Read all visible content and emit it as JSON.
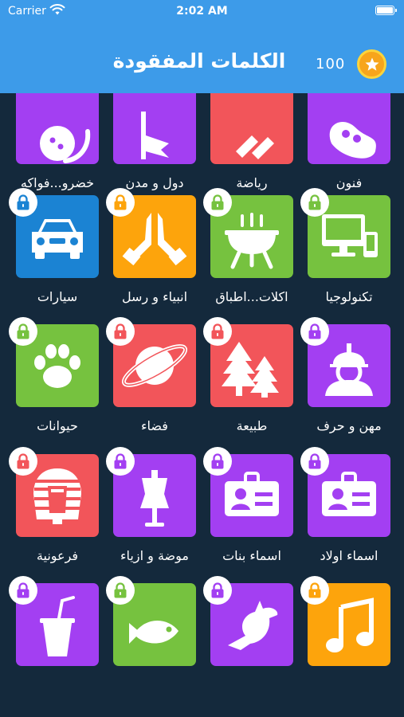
{
  "status_bar": {
    "carrier": "Carrier",
    "time": "2:02 AM"
  },
  "header": {
    "title": "الكلمات المفقودة",
    "coins": "100"
  },
  "colors": {
    "header": "#3d9be9",
    "background": "#14293c",
    "coin": "#f7a51c",
    "purple": "#a33ff2",
    "red": "#f2555a",
    "green": "#76c23f",
    "orange": "#fda40c",
    "blue": "#1b83d3"
  },
  "categories": [
    {
      "label": "فنون",
      "color": "#a33ff2",
      "icon": "palette-icon",
      "locked": false
    },
    {
      "label": "رياضة",
      "color": "#f2555a",
      "icon": "sport-icon",
      "locked": false
    },
    {
      "label": "دول و مدن",
      "color": "#a33ff2",
      "icon": "flag-icon",
      "locked": false
    },
    {
      "label": "خضرو...فواكه",
      "color": "#a33ff2",
      "icon": "fruit-icon",
      "locked": false
    },
    {
      "label": "تكنولوجيا",
      "color": "#76c23f",
      "icon": "computer-icon",
      "locked": true
    },
    {
      "label": "اكلات...اطباق",
      "color": "#76c23f",
      "icon": "grill-icon",
      "locked": true
    },
    {
      "label": "انبياء و رسل",
      "color": "#fda40c",
      "icon": "praying-hands-icon",
      "locked": true
    },
    {
      "label": "سيارات",
      "color": "#1b83d3",
      "icon": "car-icon",
      "locked": true
    },
    {
      "label": "مهن و حرف",
      "color": "#a33ff2",
      "icon": "worker-icon",
      "locked": true
    },
    {
      "label": "طبيعة",
      "color": "#f2555a",
      "icon": "trees-icon",
      "locked": true
    },
    {
      "label": "فضاء",
      "color": "#f2555a",
      "icon": "planet-icon",
      "locked": true
    },
    {
      "label": "حيوانات",
      "color": "#76c23f",
      "icon": "paw-icon",
      "locked": true
    },
    {
      "label": "اسماء اولاد",
      "color": "#a33ff2",
      "icon": "id-card-icon",
      "locked": true
    },
    {
      "label": "اسماء بنات",
      "color": "#a33ff2",
      "icon": "id-card-icon",
      "locked": true
    },
    {
      "label": "موضة و ازياء",
      "color": "#a33ff2",
      "icon": "mannequin-icon",
      "locked": true
    },
    {
      "label": "فرعونية",
      "color": "#f2555a",
      "icon": "pharaoh-icon",
      "locked": true
    },
    {
      "label": "",
      "color": "#fda40c",
      "icon": "music-icon",
      "locked": true
    },
    {
      "label": "",
      "color": "#a33ff2",
      "icon": "bird-icon",
      "locked": true
    },
    {
      "label": "",
      "color": "#76c23f",
      "icon": "fish-icon",
      "locked": true
    },
    {
      "label": "",
      "color": "#a33ff2",
      "icon": "drink-icon",
      "locked": true
    }
  ]
}
